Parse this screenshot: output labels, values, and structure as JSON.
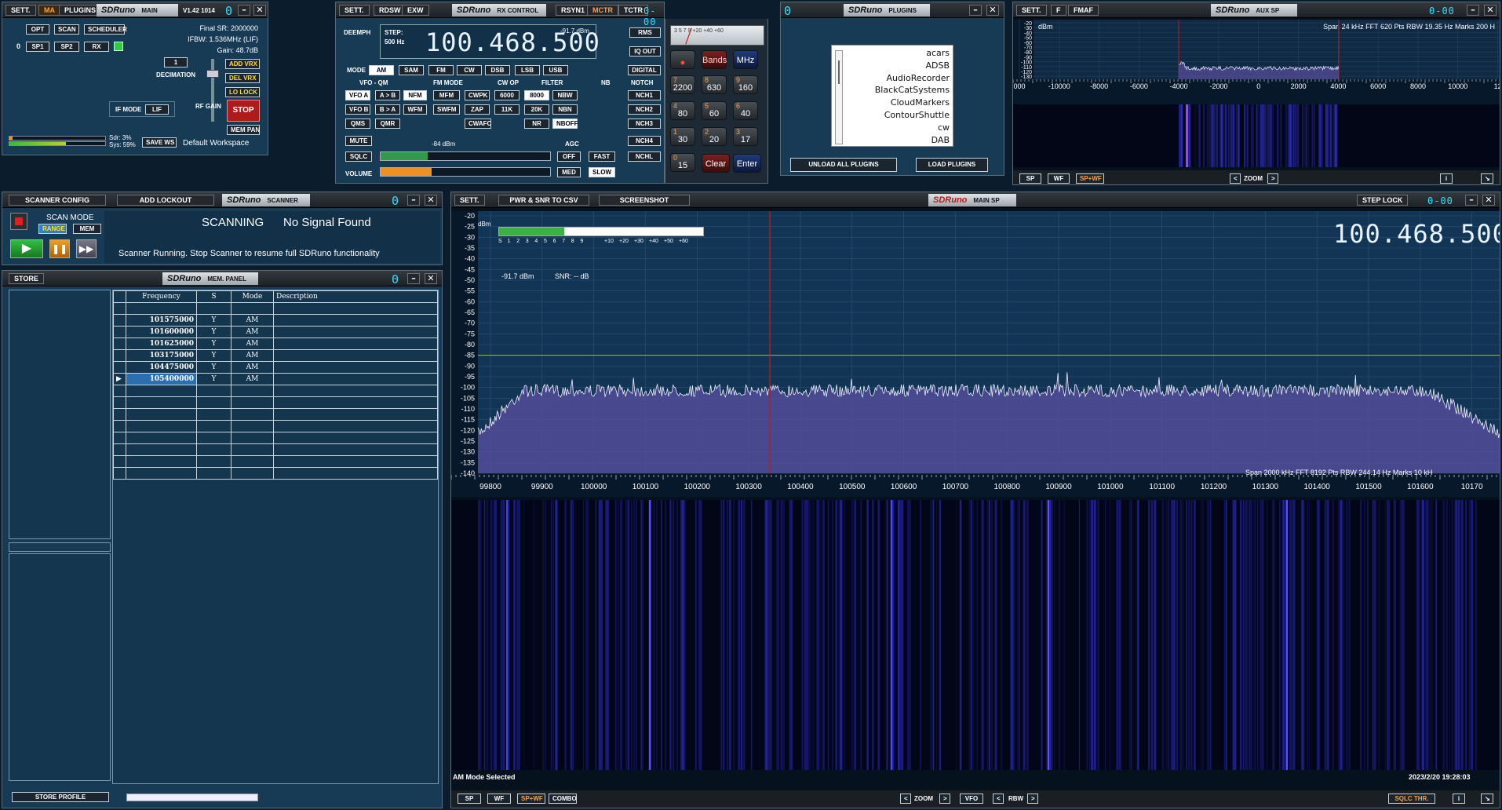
{
  "main": {
    "sett": "SETT.",
    "ma": "MA",
    "plugins": "PLUGINS",
    "logo": "SDRuno",
    "logo_sub": "MAIN",
    "version": "V1.42 1014",
    "seg": "0",
    "opt": "OPT",
    "scan": "SCAN",
    "scheduler": "SCHEDULER",
    "zero": "0",
    "sp1": "SP1",
    "sp2": "SP2",
    "rx": "RX",
    "final_sr": "Final SR: 2000000",
    "ifbw": "IFBW: 1.536MHz (LIF)",
    "gain": "Gain: 48.7dB",
    "decimation_value": "1",
    "decimation": "DECIMATION",
    "add_vrx": "ADD VRX",
    "del_vrx": "DEL VRX",
    "lo_lock": "LO LOCK",
    "if_mode": "IF MODE",
    "lif": "LIF",
    "rf_gain": "RF GAIN",
    "stop": "STOP",
    "mem_pan": "MEM PAN",
    "sdr": "Sdr: 3%",
    "sys": "Sys: 59%",
    "save_ws": "SAVE WS",
    "workspace": "Default Workspace",
    "sdr_load": 0.03,
    "sys_load": 0.59
  },
  "rxc": {
    "sett": "SETT.",
    "rdsw": "RDSW",
    "exw": "EXW",
    "logo": "SDRuno",
    "logo_sub": "RX CONTROL",
    "rsyn1": "RSYN1",
    "mctr": "MCTR",
    "tctr": "TCTR",
    "seg": "0-00",
    "deemph": "DEEMPH",
    "step": "STEP:",
    "step_val": "500 Hz",
    "freq": "100.468.500",
    "dbm": "-91.7 dBm",
    "rms": "RMS",
    "iq_out": "IQ OUT",
    "digital": "DIGITAL",
    "mode": "MODE",
    "modes": [
      "AM",
      "SAM",
      "FM",
      "CW",
      "DSB",
      "LSB",
      "USB"
    ],
    "vfo_qm": "VFO - QM",
    "fm_mode": "FM MODE",
    "cw_op": "CW OP",
    "filter": "FILTER",
    "nb": "NB",
    "notch": "NOTCH",
    "row1": [
      "VFO A",
      "A > B",
      "NFM",
      "MFM",
      "CWPK",
      "6000",
      "8000",
      "NBW",
      "NCH1"
    ],
    "row2": [
      "VFO B",
      "B > A",
      "WFM",
      "SWFM",
      "ZAP",
      "11K",
      "20K",
      "NBN",
      "NCH2"
    ],
    "row3": [
      "QMS",
      "QMR",
      "CWAFC",
      "NR",
      "NBOFF",
      "NCH3"
    ],
    "mute": "MUTE",
    "nch4": "NCH4",
    "dbm_label": "-84 dBm",
    "agc": "AGC",
    "sqlc": "SQLC",
    "off": "OFF",
    "fast": "FAST",
    "nchl": "NCHL",
    "volume": "VOLUME",
    "med": "MED",
    "slow": "SLOW",
    "signal_level": 0.28,
    "volume_level": 0.3,
    "meter_scale": "3 5 7 9 +20 +40 +60",
    "bands": "Bands",
    "mhz": "MHz",
    "keys": [
      {
        "n": "7",
        "v": "2200"
      },
      {
        "n": "8",
        "v": "630"
      },
      {
        "n": "9",
        "v": "160"
      },
      {
        "n": "4",
        "v": "80"
      },
      {
        "n": "5",
        "v": "60"
      },
      {
        "n": "6",
        "v": "40"
      },
      {
        "n": "1",
        "v": "30"
      },
      {
        "n": "2",
        "v": "20"
      },
      {
        "n": "3",
        "v": "17"
      },
      {
        "n": "0",
        "v": "15"
      }
    ],
    "clear": "Clear",
    "enter": "Enter"
  },
  "plugins": {
    "seg": "0",
    "logo": "SDRuno",
    "logo_sub": "PLUGINS",
    "list": [
      "acars",
      "ADSB",
      "AudioRecorder",
      "BlackCatSystems",
      "CloudMarkers",
      "ContourShuttle",
      "cw",
      "DAB"
    ],
    "unload": "UNLOAD ALL PLUGINS",
    "load": "LOAD PLUGINS"
  },
  "aux": {
    "sett": "SETT.",
    "f": "F",
    "fmaf": "FMAF",
    "logo": "SDRuno",
    "logo_sub": "AUX SP",
    "seg": "0-00",
    "dbm": "dBm",
    "info": "Span 24 kHz   FFT 620 Pts   RBW 19.35 Hz   Marks 200 H",
    "ylabels": [
      "-20",
      "-30",
      "-40",
      "-50",
      "-60",
      "-70",
      "-80",
      "-90",
      "-100",
      "-110",
      "-120",
      "-130"
    ],
    "xlabels": [
      "000",
      "-10000",
      "-8000",
      "-6000",
      "-4000",
      "-2000",
      "0",
      "2000",
      "4000",
      "6000",
      "8000",
      "10000",
      "12"
    ],
    "sp": "SP",
    "wf": "WF",
    "spwf": "SP+WF",
    "zoom": "ZOOM",
    "i": "i"
  },
  "scanner": {
    "config": "SCANNER CONFIG",
    "add_lockout": "ADD LOCKOUT",
    "logo": "SDRuno",
    "logo_sub": "SCANNER",
    "seg": "0",
    "scan_mode": "SCAN MODE",
    "range": "RANGE",
    "mem": "MEM",
    "scanning": "SCANNING",
    "no_signal": "No Signal Found",
    "status": "Scanner Running. Stop Scanner to resume full SDRuno functionality"
  },
  "mem": {
    "store": "STORE",
    "logo": "SDRuno",
    "logo_sub": "MEM. PANEL",
    "seg": "0",
    "headers": [
      "Frequency",
      "S",
      "Mode",
      "Description"
    ],
    "rows": [
      {
        "f": "101575000",
        "s": "Y",
        "m": "AM"
      },
      {
        "f": "101600000",
        "s": "Y",
        "m": "AM"
      },
      {
        "f": "101625000",
        "s": "Y",
        "m": "AM"
      },
      {
        "f": "103175000",
        "s": "Y",
        "m": "AM"
      },
      {
        "f": "104475000",
        "s": "Y",
        "m": "AM"
      },
      {
        "f": "105400000",
        "s": "Y",
        "m": "AM"
      }
    ],
    "store_profile": "STORE PROFILE"
  },
  "mainsp": {
    "sett": "SETT.",
    "pwr": "PWR & SNR TO CSV",
    "screenshot": "SCREENSHOT",
    "logo": "SDRuno",
    "logo_sub": "MAIN SP",
    "step_lock": "STEP LOCK",
    "seg": "0-00",
    "dbm": "dBm",
    "freq": "100.468.500",
    "smeter_scale": [
      "S",
      "1",
      "2",
      "3",
      "4",
      "5",
      "6",
      "7",
      "8",
      "9",
      "+10",
      "+20",
      "+30",
      "+40",
      "+50",
      "+60"
    ],
    "smeter_level": 0.32,
    "level": "-91.7 dBm",
    "snr": "SNR: -- dB",
    "ylabels": [
      "-20",
      "-25",
      "-30",
      "-35",
      "-40",
      "-45",
      "-50",
      "-55",
      "-60",
      "-65",
      "-70",
      "-75",
      "-80",
      "-85",
      "-90",
      "-95",
      "-100",
      "-105",
      "-110",
      "-115",
      "-120",
      "-125",
      "-130",
      "-135",
      "-140"
    ],
    "xlabels": [
      "99800",
      "99900",
      "100000",
      "100100",
      "100200",
      "100300",
      "100400",
      "100500",
      "100600",
      "100700",
      "100800",
      "100900",
      "101000",
      "101100",
      "101200",
      "101300",
      "101400",
      "101500",
      "101600",
      "10170"
    ],
    "info": "Span 2000 kHz   FFT 8192 Pts   RBW 244.14 Hz   Marks 10 kH",
    "mode_status": "AM Mode Selected",
    "datetime": "2023/2/20 19:28:03",
    "sp": "SP",
    "wf": "WF",
    "spwf": "SP+WF",
    "combo": "COMBO",
    "zoom": "ZOOM",
    "vfo": "VFO",
    "rbw": "RBW",
    "sqlc_thr": "SQLC THR.",
    "i": "i"
  }
}
